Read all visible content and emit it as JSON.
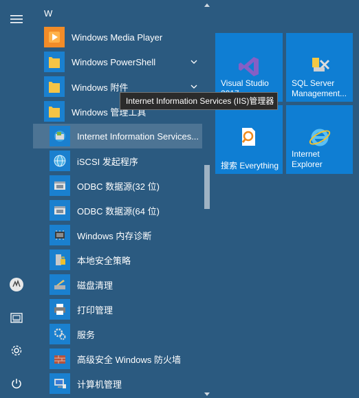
{
  "list": {
    "letter": "W",
    "items": [
      {
        "label": "Windows Media Player",
        "icon": "media-player-icon",
        "expandable": false
      },
      {
        "label": "Windows PowerShell",
        "icon": "folder-icon",
        "expandable": true
      },
      {
        "label": "Windows 附件",
        "icon": "folder-icon",
        "expandable": true
      },
      {
        "label": "Windows 管理工具",
        "icon": "folder-icon",
        "expandable": false
      },
      {
        "label": "Internet Information Services...",
        "icon": "iis-manager-icon",
        "selected": true
      },
      {
        "label": "iSCSI 发起程序",
        "icon": "iscsi-globe-icon"
      },
      {
        "label": "ODBC 数据源(32 位)",
        "icon": "odbc-32-icon"
      },
      {
        "label": "ODBC 数据源(64 位)",
        "icon": "odbc-64-icon"
      },
      {
        "label": "Windows 内存诊断",
        "icon": "memory-chip-icon"
      },
      {
        "label": "本地安全策略",
        "icon": "security-policy-icon"
      },
      {
        "label": "磁盘清理",
        "icon": "disk-cleanup-icon"
      },
      {
        "label": "打印管理",
        "icon": "printer-icon"
      },
      {
        "label": "服务",
        "icon": "services-gear-icon"
      },
      {
        "label": "高级安全 Windows 防火墙",
        "icon": "firewall-icon"
      },
      {
        "label": "计算机管理",
        "icon": "computer-management-icon"
      }
    ]
  },
  "rail": {
    "items": [
      "hamburger-menu-icon",
      "user-avatar-icon",
      "documents-icon",
      "settings-gear-icon",
      "power-icon"
    ]
  },
  "tiles": [
    {
      "label": "Visual Studio 2017",
      "icon": "visual-studio-icon"
    },
    {
      "label": "SQL Server Management...",
      "icon": "sql-server-icon"
    },
    {
      "label": "搜索 Everything",
      "icon": "everything-search-icon"
    },
    {
      "label": "Internet Explorer",
      "icon": "internet-explorer-icon"
    }
  ],
  "tooltip": {
    "text": "Internet Information Services (IIS)管理器"
  },
  "colors": {
    "background": "#2b5a80",
    "tile": "#0f7ed3",
    "icon_tile": "#1a80cf",
    "folder": "#f6c445",
    "tooltip_bg": "#2b2b2b"
  }
}
